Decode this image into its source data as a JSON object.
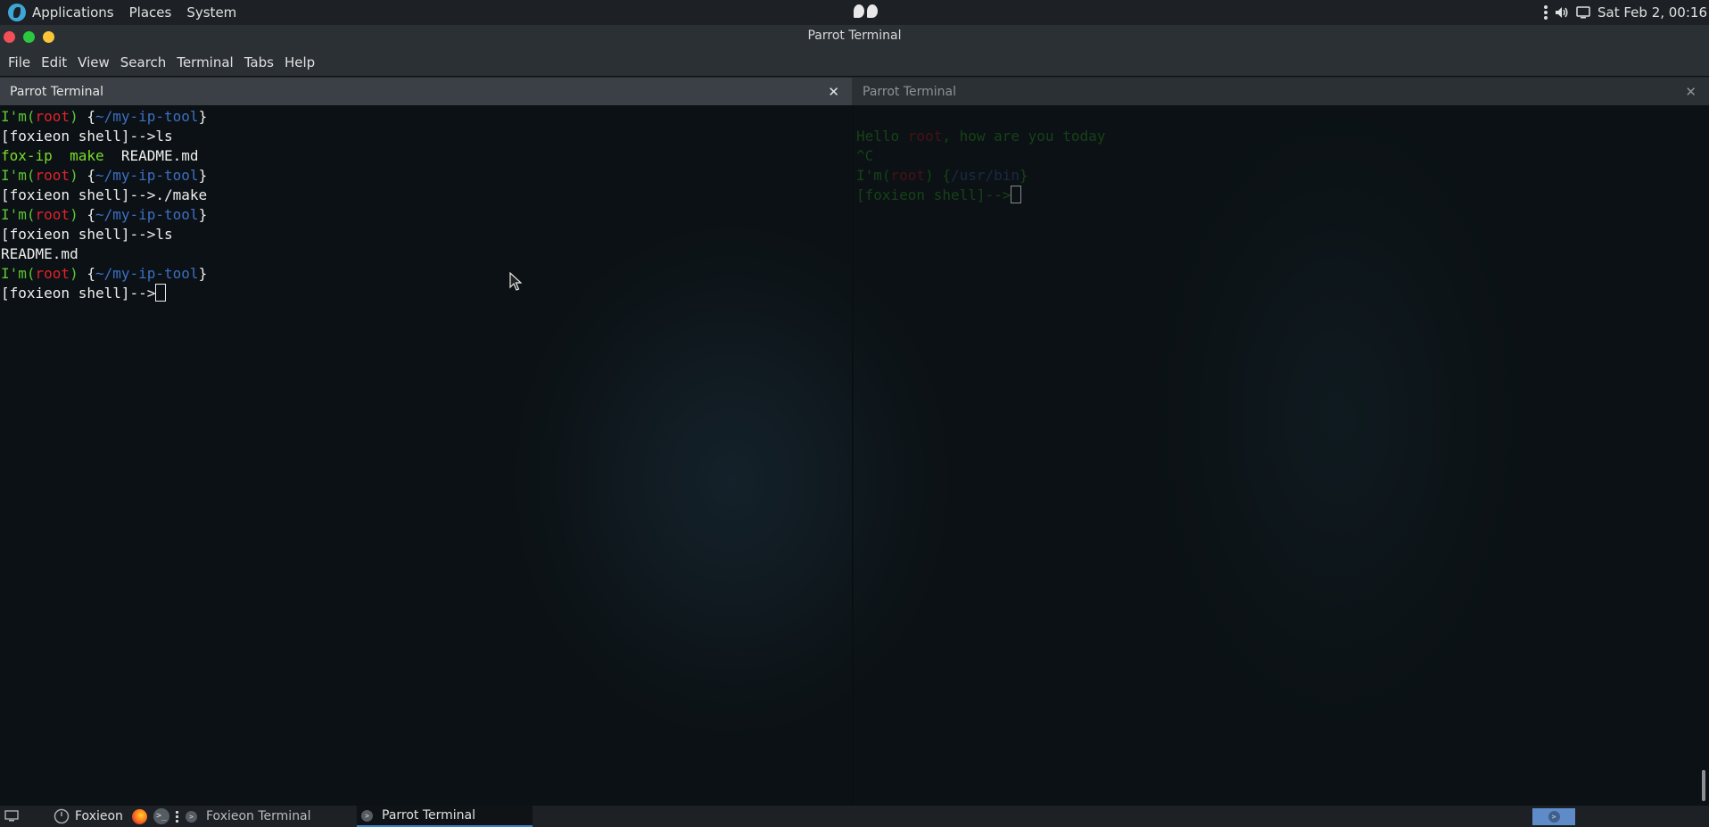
{
  "top_panel": {
    "menu": [
      "Applications",
      "Places",
      "System"
    ],
    "clock": "Sat Feb  2, 00:16",
    "icons": [
      "parrot-logo-icon",
      "kebab-menu-icon",
      "volume-icon",
      "display-icon"
    ]
  },
  "window": {
    "title": "Parrot Terminal"
  },
  "menubar": [
    "File",
    "Edit",
    "View",
    "Search",
    "Terminal",
    "Tabs",
    "Help"
  ],
  "tabs": [
    {
      "label": "Parrot Terminal",
      "close": "✕"
    },
    {
      "label": "Parrot Terminal",
      "close": "✕"
    }
  ],
  "terminal_left": {
    "lines": [
      [
        [
          "g",
          "I'm("
        ],
        [
          "r",
          "root"
        ],
        [
          "g",
          ") "
        ],
        [
          "w",
          "{"
        ],
        [
          "b",
          "~/my-ip-tool"
        ],
        [
          "w",
          "}"
        ]
      ],
      [
        [
          "w",
          "[foxieon shell]-->ls"
        ]
      ],
      [
        [
          "exe",
          "fox-ip"
        ],
        [
          "w",
          "  "
        ],
        [
          "exe",
          "make"
        ],
        [
          "w",
          "  README.md"
        ]
      ],
      [
        [
          "g",
          "I'm("
        ],
        [
          "r",
          "root"
        ],
        [
          "g",
          ") "
        ],
        [
          "w",
          "{"
        ],
        [
          "b",
          "~/my-ip-tool"
        ],
        [
          "w",
          "}"
        ]
      ],
      [
        [
          "w",
          "[foxieon shell]-->./make"
        ]
      ],
      [
        [
          "g",
          "I'm("
        ],
        [
          "r",
          "root"
        ],
        [
          "g",
          ") "
        ],
        [
          "w",
          "{"
        ],
        [
          "b",
          "~/my-ip-tool"
        ],
        [
          "w",
          "}"
        ]
      ],
      [
        [
          "w",
          "[foxieon shell]-->ls"
        ]
      ],
      [
        [
          "w",
          "README.md"
        ]
      ],
      [
        [
          "g",
          "I'm("
        ],
        [
          "r",
          "root"
        ],
        [
          "g",
          ") "
        ],
        [
          "w",
          "{"
        ],
        [
          "b",
          "~/my-ip-tool"
        ],
        [
          "w",
          "}"
        ]
      ],
      [
        [
          "w",
          "[foxieon shell]-->"
        ]
      ]
    ]
  },
  "terminal_right": {
    "lines": [
      [],
      [
        [
          "g",
          "Hello "
        ],
        [
          "r",
          "root"
        ],
        [
          "g",
          ", how are you today"
        ]
      ],
      [
        [
          "g",
          "^C"
        ]
      ],
      [
        [
          "g",
          "I'm("
        ],
        [
          "r",
          "root"
        ],
        [
          "g",
          ") "
        ],
        [
          "w",
          "{"
        ],
        [
          "b",
          "/usr/bin"
        ],
        [
          "w",
          "}"
        ]
      ],
      [
        [
          "w",
          "[foxieon shell]-->"
        ]
      ]
    ]
  },
  "bottom_panel": {
    "tasks": [
      {
        "label": "Foxieon"
      },
      {
        "label": "Foxieon Terminal"
      },
      {
        "label": "Parrot Terminal"
      }
    ]
  }
}
